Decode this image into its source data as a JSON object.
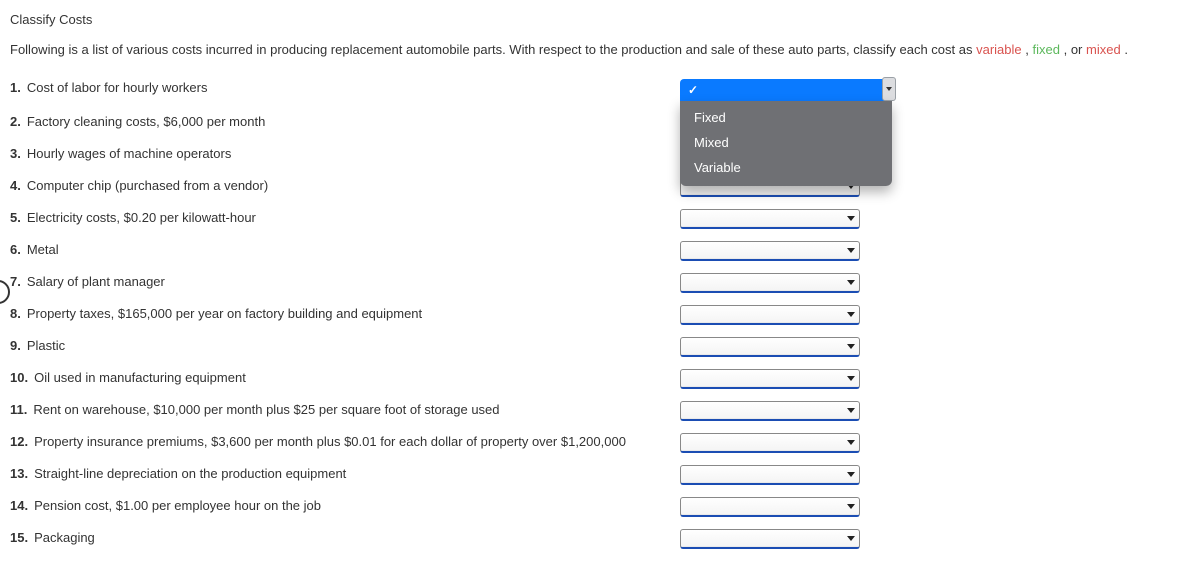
{
  "title": "Classify Costs",
  "intro": {
    "prefix": "Following is a list of various costs incurred in producing replacement automobile parts. With respect to the production and sale of these auto parts, classify each cost as ",
    "variable": "variable",
    "sep1": ", ",
    "fixed": "fixed",
    "sep2": ", or ",
    "mixed": "mixed",
    "suffix": "."
  },
  "options": [
    "Fixed",
    "Mixed",
    "Variable"
  ],
  "items": [
    {
      "num": "1.",
      "label": "Cost of labor for hourly workers",
      "open": true
    },
    {
      "num": "2.",
      "label": "Factory cleaning costs, $6,000 per month"
    },
    {
      "num": "3.",
      "label": "Hourly wages of machine operators"
    },
    {
      "num": "4.",
      "label": "Computer chip (purchased from a vendor)"
    },
    {
      "num": "5.",
      "label": "Electricity costs, $0.20 per kilowatt-hour"
    },
    {
      "num": "6.",
      "label": "Metal"
    },
    {
      "num": "7.",
      "label": "Salary of plant manager"
    },
    {
      "num": "8.",
      "label": "Property taxes, $165,000 per year on factory building and equipment"
    },
    {
      "num": "9.",
      "label": "Plastic"
    },
    {
      "num": "10.",
      "label": "Oil used in manufacturing equipment"
    },
    {
      "num": "11.",
      "label": "Rent on warehouse, $10,000 per month plus $25 per square foot of storage used"
    },
    {
      "num": "12.",
      "label": "Property insurance premiums, $3,600 per month plus $0.01 for each dollar of property over $1,200,000"
    },
    {
      "num": "13.",
      "label": "Straight-line depreciation on the production equipment"
    },
    {
      "num": "14.",
      "label": "Pension cost, $1.00 per employee hour on the job"
    },
    {
      "num": "15.",
      "label": "Packaging"
    }
  ]
}
